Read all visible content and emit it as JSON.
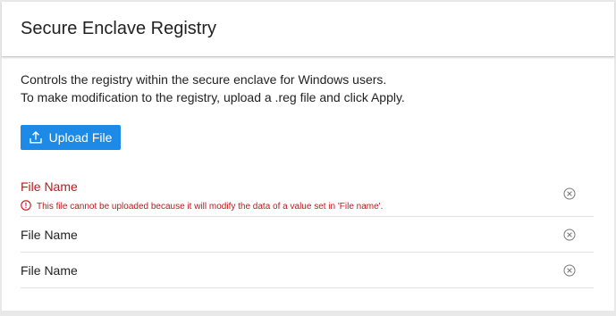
{
  "header": {
    "title": "Secure Enclave Registry"
  },
  "description": {
    "line1": "Controls the registry within the secure enclave for Windows users.",
    "line2": "To make modification to the registry, upload a .reg file and click Apply."
  },
  "upload_button": {
    "label": "Upload File",
    "icon": "upload-icon",
    "color": "#1e8ae7"
  },
  "files": [
    {
      "name": "File Name",
      "status": "error",
      "error_icon": "error-icon",
      "error_message": "This file cannot be uploaded because it will modify the data of a value set in 'File name'.",
      "remove_icon": "close-circle-icon"
    },
    {
      "name": "File Name",
      "status": "ok",
      "remove_icon": "close-circle-icon"
    },
    {
      "name": "File Name",
      "status": "ok",
      "remove_icon": "close-circle-icon"
    }
  ],
  "colors": {
    "error": "#c0161c",
    "accent": "#1e8ae7",
    "divider": "#e2e2e2"
  }
}
